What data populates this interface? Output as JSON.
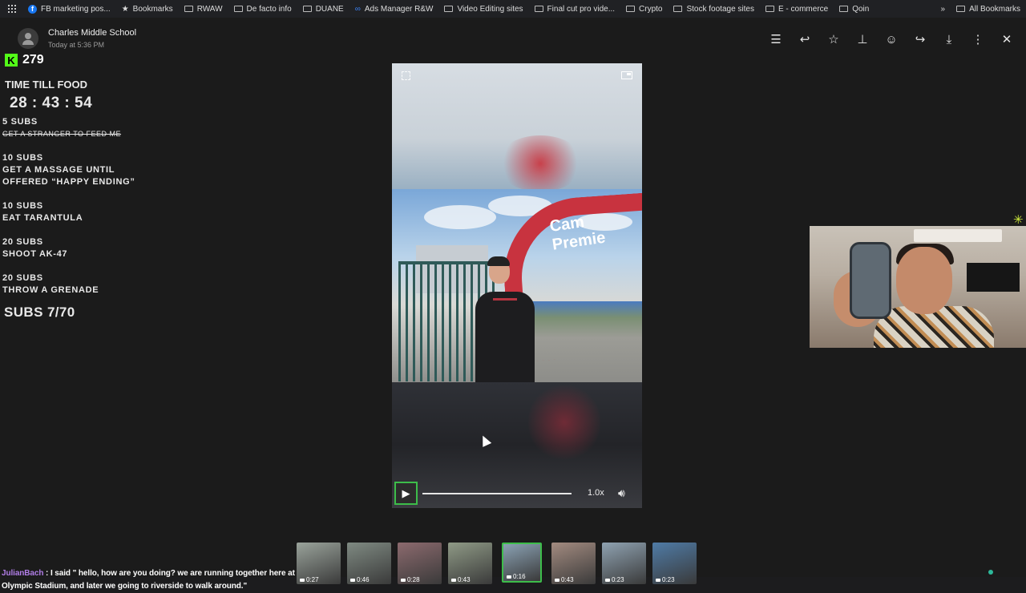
{
  "bookmarks_bar": {
    "items": [
      {
        "label": "FB marketing pos...",
        "icon": "facebook-icon"
      },
      {
        "label": "Bookmarks",
        "icon": "star-icon"
      },
      {
        "label": "RWAW",
        "icon": "folder-icon"
      },
      {
        "label": "De facto info",
        "icon": "folder-icon"
      },
      {
        "label": "DUANE",
        "icon": "folder-icon"
      },
      {
        "label": "Ads Manager R&W",
        "icon": "meta-icon"
      },
      {
        "label": "Video Editing sites",
        "icon": "folder-icon"
      },
      {
        "label": "Final cut pro vide...",
        "icon": "folder-icon"
      },
      {
        "label": "Crypto",
        "icon": "folder-icon"
      },
      {
        "label": "Stock footage sites",
        "icon": "folder-icon"
      },
      {
        "label": "E - commerce",
        "icon": "folder-icon"
      },
      {
        "label": "Qoin",
        "icon": "folder-icon"
      }
    ],
    "overflow_label": "»",
    "all_bookmarks_label": "All Bookmarks"
  },
  "message": {
    "sender": "Charles Middle School",
    "timestamp": "Today at 5:36 PM"
  },
  "toolbar": {
    "icons": [
      "summary-icon",
      "reply-icon",
      "star-icon",
      "pin-icon",
      "emoji-icon",
      "forward-icon",
      "download-icon",
      "more-icon",
      "close-icon"
    ]
  },
  "overlay": {
    "kick_logo": "K",
    "kick_count": "279",
    "timer_title": "TIME TILL FOOD",
    "timer": "28 : 43 : 54",
    "goals": [
      {
        "subs": "5 SUBS",
        "task": "GET A STRANGER TO FEED ME",
        "done": true
      },
      {
        "subs": "10 SUBS",
        "task": "GET A MASSAGE UNTIL",
        "task2": "OFFERED “HAPPY ENDING”",
        "done": false
      },
      {
        "subs": "10 SUBS",
        "task": "EAT TARANTULA",
        "done": false
      },
      {
        "subs": "20 SUBS",
        "task": "SHOOT AK-47",
        "done": false
      },
      {
        "subs": "20 SUBS",
        "task": "THROW A GRENADE",
        "done": false
      }
    ],
    "subs_progress": "SUBS 7/70"
  },
  "video": {
    "sign_text": "Cam Premie",
    "speed": "1.0x",
    "progress_fraction": 0.0
  },
  "chat": {
    "username": "JulianBach",
    "separator": " : ",
    "line1": "I said \" hello, how are you doing? we are running together here at",
    "line2": "Olympic Stadium, and later we going to riverside to walk around.\""
  },
  "thumbnails": [
    {
      "duration": "0:27",
      "color": "#9aa39b"
    },
    {
      "duration": "0:46",
      "color": "#7f8a82"
    },
    {
      "duration": "0:28",
      "color": "#8c6a6e"
    },
    {
      "duration": "0:43",
      "color": "#8f9a86"
    },
    {
      "duration": "0:16",
      "color": "#8aa1b3",
      "active": true
    },
    {
      "duration": "0:43",
      "color": "#a38b80"
    },
    {
      "duration": "0:23",
      "color": "#8fa2b1"
    },
    {
      "duration": "0:23",
      "color": "#4f7ba6"
    }
  ],
  "colors": {
    "accent_green": "#3dbd4a",
    "kick_green": "#53fc18",
    "chat_user": "#b17ee8"
  }
}
